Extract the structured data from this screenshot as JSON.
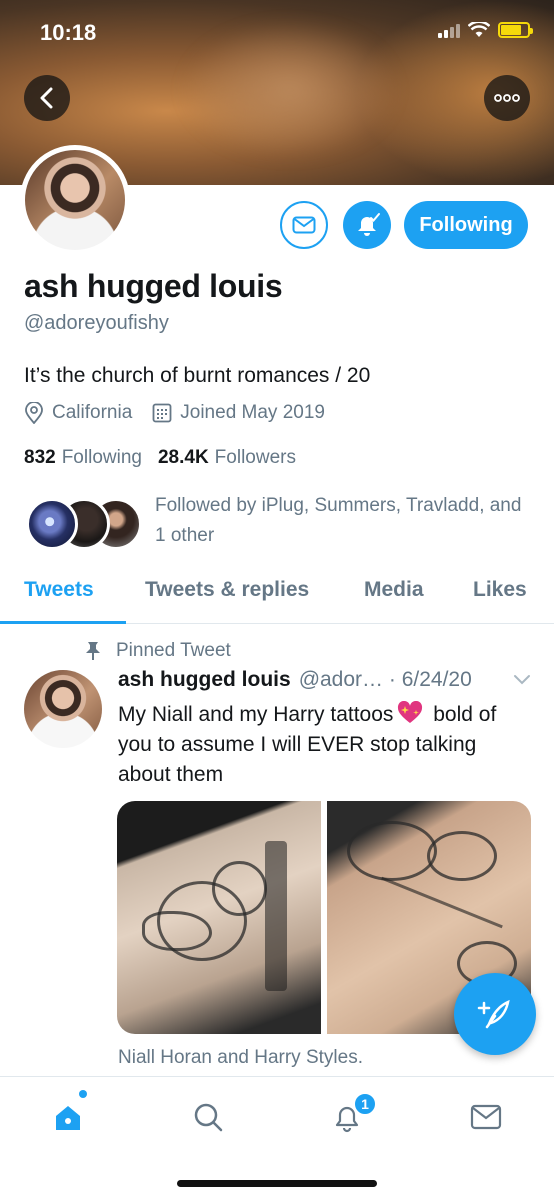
{
  "status_bar": {
    "time": "10:18"
  },
  "profile": {
    "display_name": "ash hugged louis",
    "handle": "@adoreyoufishy",
    "bio": "It’s the church of burnt romances / 20",
    "location": "California",
    "joined": "Joined May 2019",
    "following_count": "832",
    "following_label": "Following",
    "followers_count": "28.4K",
    "followers_label": "Followers",
    "followed_by": "Followed by iPlug, Summers, Travladd, and 1 other",
    "follow_button_label": "Following"
  },
  "tabs": [
    "Tweets",
    "Tweets & replies",
    "Media",
    "Likes"
  ],
  "active_tab": "Tweets",
  "pinned_tweet": {
    "pinned_label": "Pinned Tweet",
    "author_name": "ash hugged louis",
    "author_handle_date": "@ador… · 6/24/20",
    "text_before_emoji": "My Niall and my Harry tattoos",
    "text_after_emoji": " bold of you to assume I will EVER stop talking about them",
    "emoji": "sparkling-heart",
    "media_caption": "Niall Horan and Harry Styles."
  },
  "bottom_nav": {
    "items": [
      "home-icon",
      "search-icon",
      "notifications-icon",
      "messages-icon"
    ],
    "notifications_badge": "1"
  },
  "colors": {
    "accent": "#1da1f2",
    "secondary_text": "#657786",
    "primary_text": "#14171a"
  }
}
